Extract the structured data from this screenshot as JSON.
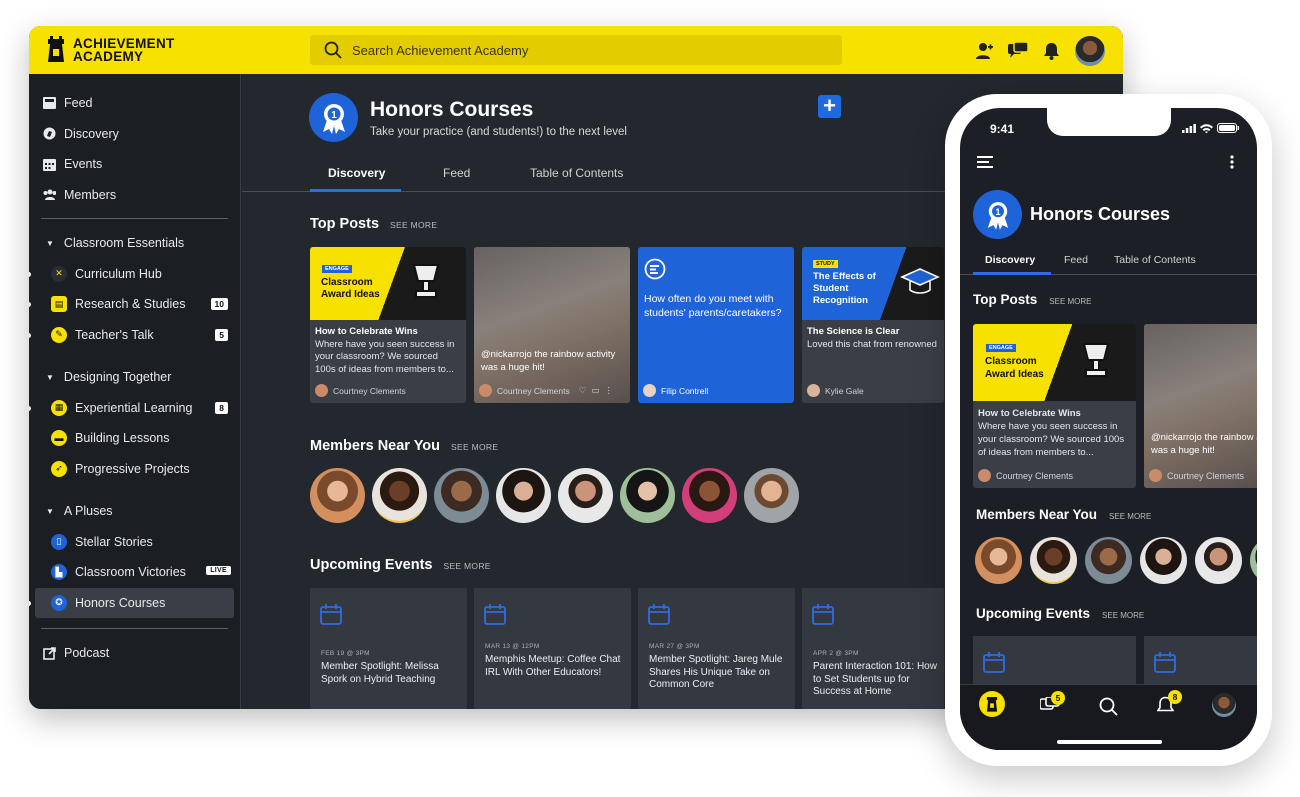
{
  "brand": {
    "line1": "ACHIEVEMENT",
    "line2": "ACADEMY",
    "accent": "#f6e100",
    "blue": "#1f63d9"
  },
  "search": {
    "placeholder": "Search Achievement Academy"
  },
  "topbar_icons": [
    "add-person-icon",
    "chat-bubbles-icon",
    "bell-icon",
    "user-avatar"
  ],
  "sidebar": {
    "top": [
      {
        "label": "Feed",
        "icon": "feed-icon"
      },
      {
        "label": "Discovery",
        "icon": "compass-icon"
      },
      {
        "label": "Events",
        "icon": "calendar-icon"
      },
      {
        "label": "Members",
        "icon": "members-icon"
      }
    ],
    "groups": [
      {
        "title": "Classroom Essentials",
        "items": [
          {
            "label": "Curriculum Hub",
            "badge": ""
          },
          {
            "label": "Research & Studies",
            "badge": "10"
          },
          {
            "label": "Teacher's Talk",
            "badge": "5"
          }
        ]
      },
      {
        "title": "Designing Together",
        "items": [
          {
            "label": "Experiential Learning",
            "badge": "8"
          },
          {
            "label": "Building Lessons",
            "badge": ""
          },
          {
            "label": "Progressive Projects",
            "badge": ""
          }
        ]
      },
      {
        "title": "A Pluses",
        "items": [
          {
            "label": "Stellar Stories",
            "badge": ""
          },
          {
            "label": "Classroom Victories",
            "badge": "LIVE"
          },
          {
            "label": "Honors Courses",
            "badge": ""
          }
        ]
      }
    ],
    "bottom": {
      "label": "Podcast",
      "icon": "external-link-icon"
    }
  },
  "page": {
    "title": "Honors Courses",
    "subtitle": "Take your practice (and students!) to the next level"
  },
  "tabs": [
    "Discovery",
    "Feed",
    "Table of Contents"
  ],
  "sections": {
    "top_posts": "Top Posts",
    "members": "Members Near You",
    "events": "Upcoming Events",
    "see_more": "SEE MORE"
  },
  "posts": [
    {
      "tag": "ENGAGE",
      "img_title": "Classroom Award Ideas",
      "title": "How to Celebrate Wins",
      "text": "Where have you seen success in your classroom? We sourced 100s of ideas from members to...",
      "author": "Courtney Clements"
    },
    {
      "tag": "",
      "img_title": "",
      "title": "",
      "text": "@nickarrojo the rainbow activity was a huge hit!",
      "author": "Courtney Clements"
    },
    {
      "tag": "",
      "img_title": "",
      "title": "",
      "text": "How often do you meet with students' parents/caretakers?",
      "author": "Filip Contrell"
    },
    {
      "tag": "STUDY",
      "img_title": "The Effects of Student Recognition",
      "title": "The Science is Clear",
      "text": "Loved this chat from renowned educator Peter Tungsten on how student recognition pays divid...",
      "author": "Kylie Gale"
    }
  ],
  "events": [
    {
      "date": "FEB 19 @ 3PM",
      "title": "Member Spotlight: Melissa Spork on Hybrid Teaching"
    },
    {
      "date": "MAR 13 @ 12PM",
      "title": "Memphis Meetup: Coffee Chat IRL With Other Educators!"
    },
    {
      "date": "MAR 27 @ 3PM",
      "title": "Member Spotlight: Jareg Mule Shares His Unique Take on Common Core"
    },
    {
      "date": "APR 2 @ 3PM",
      "title": "Parent Interaction 101: How to Set Students up for Success at Home"
    }
  ],
  "phone": {
    "time": "9:41",
    "posts": [
      {
        "tag": "ENGAGE",
        "img_title": "Classroom Award Ideas",
        "title": "How to Celebrate Wins",
        "text": "Where have you seen success in your classroom? We sourced 100s of ideas from members to...",
        "author": "Courtney Clements"
      },
      {
        "text": "@nickarrojo the rainbow activity was a huge hit!",
        "author": "Courtney Clements"
      }
    ],
    "nav_badges": {
      "chat": "5",
      "bell": "8"
    }
  }
}
